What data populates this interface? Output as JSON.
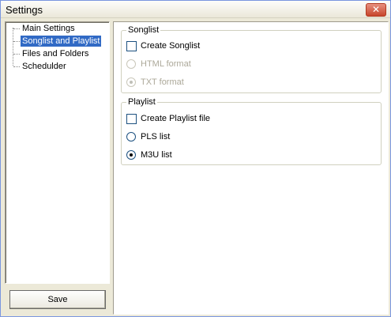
{
  "window": {
    "title": "Settings",
    "close_symbol": "✕"
  },
  "tree": {
    "items": [
      {
        "label": "Main Settings",
        "selected": false
      },
      {
        "label": "Songlist and Playlist",
        "selected": true
      },
      {
        "label": "Files and Folders",
        "selected": false
      },
      {
        "label": "Schedulder",
        "selected": false
      }
    ]
  },
  "songlist": {
    "title": "Songlist",
    "create_label": "Create Songlist",
    "create_checked": false,
    "html_label": "HTML format",
    "html_enabled": false,
    "html_selected": false,
    "txt_label": "TXT format",
    "txt_enabled": false,
    "txt_selected": true
  },
  "playlist": {
    "title": "Playlist",
    "create_label": "Create Playlist file",
    "create_checked": false,
    "pls_label": "PLS list",
    "pls_selected": false,
    "m3u_label": "M3U list",
    "m3u_selected": true
  },
  "buttons": {
    "save_label": "Save"
  }
}
